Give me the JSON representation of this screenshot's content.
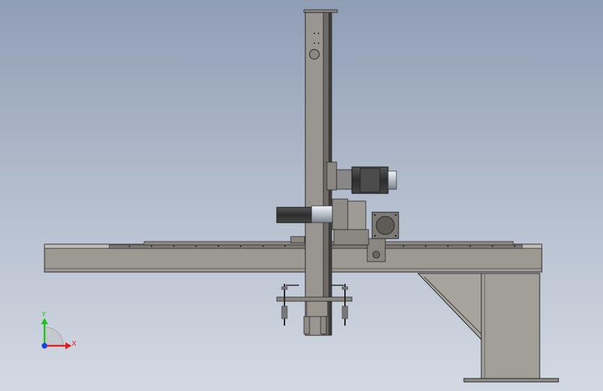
{
  "triad": {
    "y_label": "Y",
    "x_label": "X",
    "colors": {
      "x": "#e02020",
      "y": "#20c020",
      "z": "#2040e0"
    }
  },
  "model": {
    "part_colors": {
      "steel_light": "#9a958f",
      "steel_dark": "#55524e",
      "motor_body": "#3a3a3a",
      "motor_shaft": "#c8ccd4",
      "outline": "#1e1e1e"
    }
  }
}
